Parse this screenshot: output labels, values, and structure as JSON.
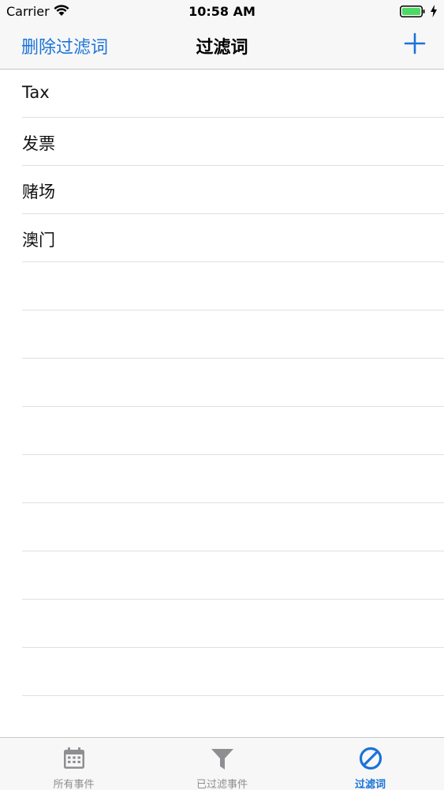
{
  "status_bar": {
    "carrier": "Carrier",
    "time": "10:58 AM",
    "icons": [
      "wifi-icon",
      "battery-icon",
      "charging-bolt-icon"
    ],
    "battery_color": "#4cd964"
  },
  "nav": {
    "left_button": "删除过滤词",
    "title": "过滤词",
    "right_icon": "plus-icon",
    "accent_color": "#1a73d9"
  },
  "filter_words": [
    {
      "label": "Tax"
    },
    {
      "label": "发票"
    },
    {
      "label": "赌场"
    },
    {
      "label": "澳门"
    }
  ],
  "tabs": [
    {
      "label": "所有事件",
      "icon": "calendar-icon",
      "active": false
    },
    {
      "label": "已过滤事件",
      "icon": "funnel-icon",
      "active": false
    },
    {
      "label": "过滤词",
      "icon": "block-icon",
      "active": true
    }
  ]
}
